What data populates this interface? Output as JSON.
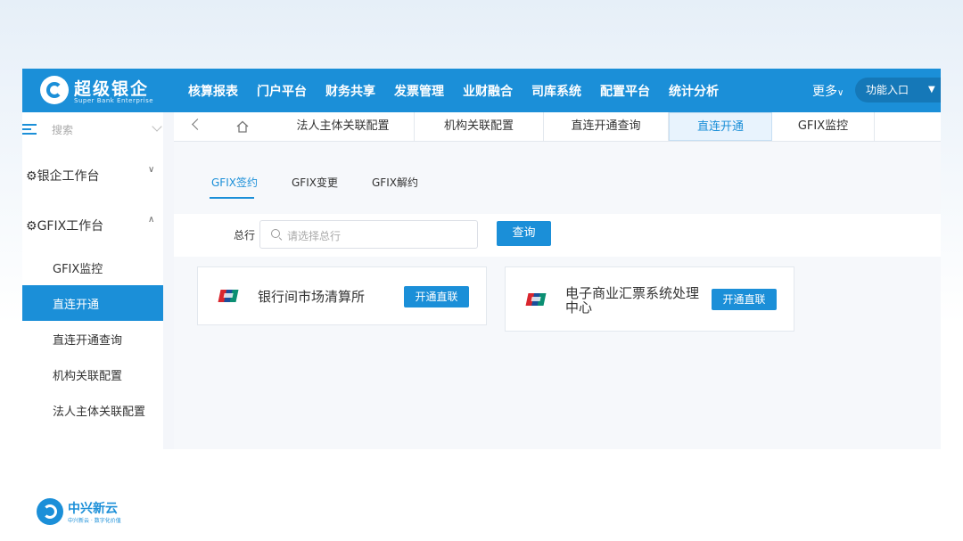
{
  "brand": {
    "name": "超级银企",
    "subtitle": "Super Bank Enterprise"
  },
  "nav": {
    "items": [
      "核算报表",
      "门户平台",
      "财务共享",
      "发票管理",
      "业财融合",
      "司库系统",
      "配置平台",
      "统计分析"
    ],
    "more": "更多",
    "function_entry": "功能入口"
  },
  "sidebar": {
    "search_placeholder": "搜索",
    "groups": [
      {
        "label": "银企工作台",
        "icon": "gear-icon",
        "expanded": false
      },
      {
        "label": "GFIX工作台",
        "icon": "gear-icon",
        "expanded": true
      }
    ],
    "items": [
      "GFIX监控",
      "直连开通",
      "直连开通查询",
      "机构关联配置",
      "法人主体关联配置"
    ],
    "active": "直连开通"
  },
  "tabs": {
    "items": [
      "法人主体关联配置",
      "机构关联配置",
      "直连开通查询",
      "直连开通",
      "GFIX监控"
    ],
    "active": "直连开通"
  },
  "subtabs": {
    "items": [
      "GFIX签约",
      "GFIX变更",
      "GFIX解约"
    ],
    "active": "GFIX签约"
  },
  "filter": {
    "label": "总行",
    "placeholder": "请选择总行",
    "query_button": "查询"
  },
  "cards": [
    {
      "title": "银行间市场清算所",
      "button": "开通直联"
    },
    {
      "title_line1": "电子商业汇票系统处理",
      "title_line2": "中心",
      "button": "开通直联"
    }
  ],
  "footer": {
    "name": "中兴新云",
    "tagline": "中兴新云 · 数字化价值"
  },
  "colors": {
    "primary": "#1b8fd8",
    "header_bg": "#1b8fd8",
    "page_bg": "#f6f8fb"
  }
}
